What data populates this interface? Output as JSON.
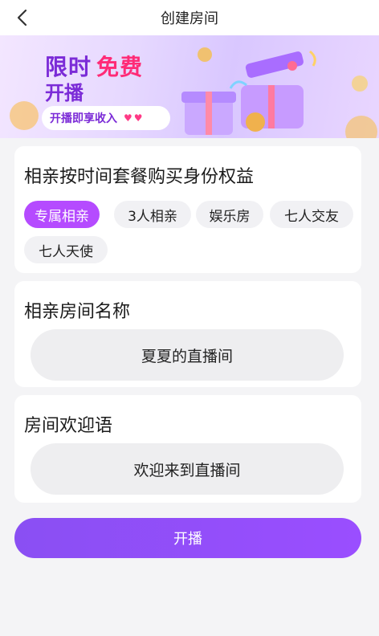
{
  "header": {
    "title": "创建房间"
  },
  "banner": {
    "headline_part1": "限时",
    "headline_part2": "免费",
    "headline_line2": "开播",
    "pill_text": "开播即享收入",
    "hearts": "♥♥"
  },
  "package": {
    "title": "相亲按时间套餐购买身份权益",
    "options": [
      "专属相亲",
      "3人相亲",
      "娱乐房",
      "七人交友",
      "七人天使"
    ],
    "selected_index": 0
  },
  "room_name": {
    "label": "相亲房间名称",
    "value": "夏夏的直播间"
  },
  "welcome": {
    "label": "房间欢迎语",
    "value": "欢迎来到直播间"
  },
  "actions": {
    "start_label": "开播"
  },
  "colors": {
    "accent": "#8a4ff3",
    "chip_selected": "#b54bff",
    "background": "#f4f4f6"
  }
}
